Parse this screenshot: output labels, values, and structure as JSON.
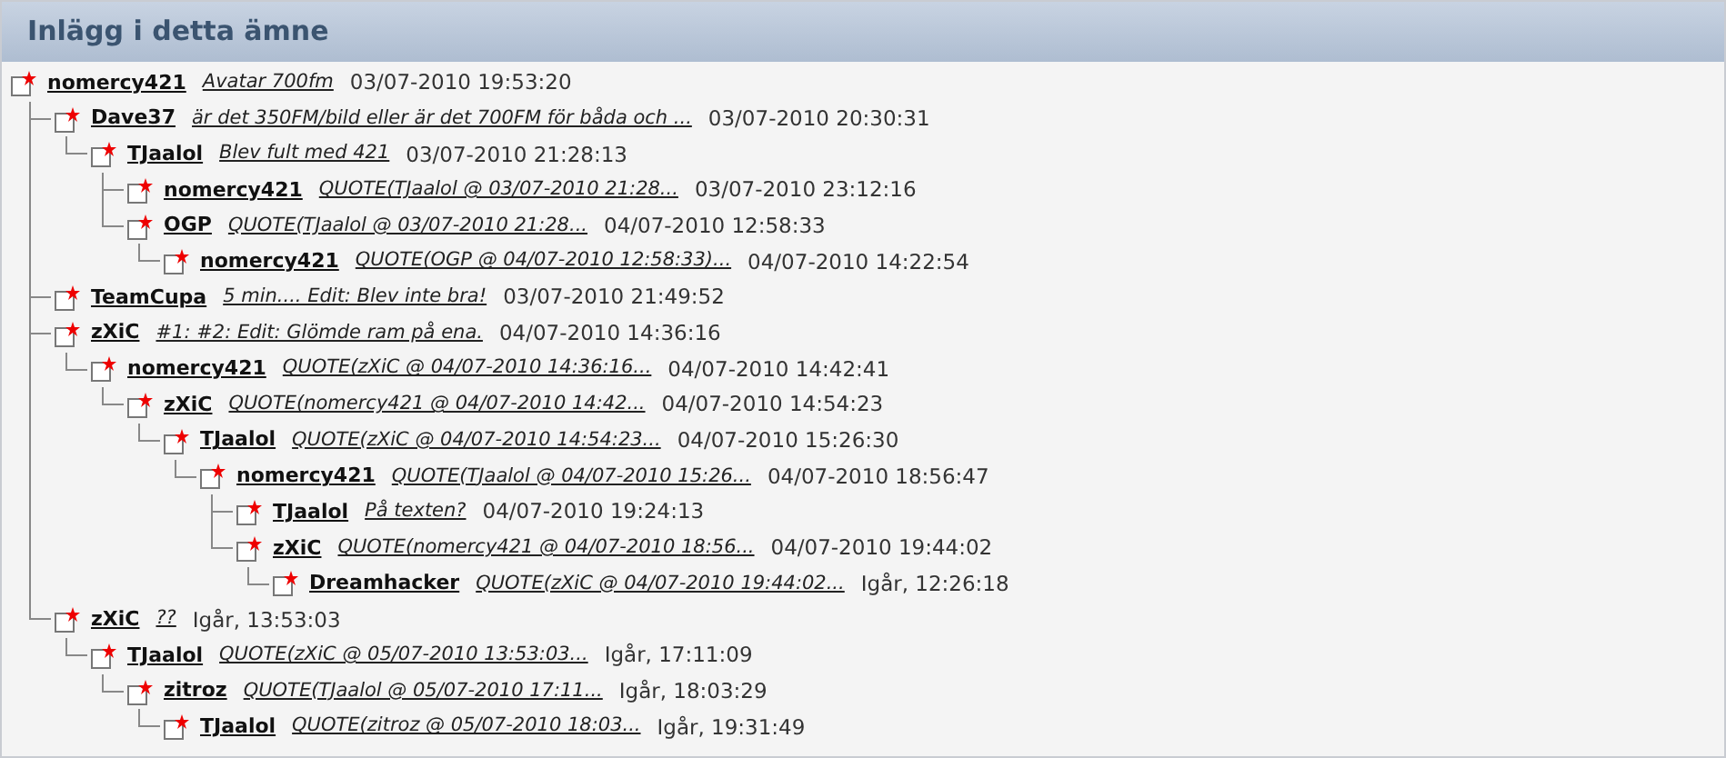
{
  "panel": {
    "title": "Inlägg i detta ämne"
  },
  "posts": [
    {
      "author": "nomercy421",
      "subject": "Avatar 700fm",
      "date": "03/07-2010 19:53:20",
      "children": [
        {
          "author": "Dave37",
          "subject": "är det 350FM/bild eller är det 700FM för båda och ...",
          "date": "03/07-2010 20:30:31",
          "children": [
            {
              "author": "TJaalol",
              "subject": "Blev fult med 421",
              "date": "03/07-2010 21:28:13",
              "children": [
                {
                  "author": "nomercy421",
                  "subject": "QUOTE(TJaalol @ 03/07-2010 21:28...",
                  "date": "03/07-2010 23:12:16"
                },
                {
                  "author": "OGP",
                  "subject": "QUOTE(TJaalol @ 03/07-2010 21:28...",
                  "date": "04/07-2010 12:58:33",
                  "children": [
                    {
                      "author": "nomercy421",
                      "subject": "QUOTE(OGP @ 04/07-2010 12:58:33)...",
                      "date": "04/07-2010 14:22:54"
                    }
                  ]
                }
              ]
            }
          ]
        },
        {
          "author": "TeamCupa",
          "subject": "5 min.... Edit: Blev inte bra!",
          "date": "03/07-2010 21:49:52"
        },
        {
          "author": "zXiC",
          "subject": "#1: #2: Edit: Glömde ram på ena.",
          "date": "04/07-2010 14:36:16",
          "children": [
            {
              "author": "nomercy421",
              "subject": "QUOTE(zXiC @ 04/07-2010 14:36:16...",
              "date": "04/07-2010 14:42:41",
              "children": [
                {
                  "author": "zXiC",
                  "subject": "QUOTE(nomercy421 @ 04/07-2010 14:42...",
                  "date": "04/07-2010 14:54:23",
                  "children": [
                    {
                      "author": "TJaalol",
                      "subject": "QUOTE(zXiC @ 04/07-2010 14:54:23...",
                      "date": "04/07-2010 15:26:30",
                      "children": [
                        {
                          "author": "nomercy421",
                          "subject": "QUOTE(TJaalol @ 04/07-2010 15:26...",
                          "date": "04/07-2010 18:56:47",
                          "children": [
                            {
                              "author": "TJaalol",
                              "subject": "På texten?",
                              "date": "04/07-2010 19:24:13"
                            },
                            {
                              "author": "zXiC",
                              "subject": "QUOTE(nomercy421 @ 04/07-2010 18:56...",
                              "date": "04/07-2010 19:44:02",
                              "children": [
                                {
                                  "author": "Dreamhacker",
                                  "subject": "QUOTE(zXiC @ 04/07-2010 19:44:02...",
                                  "date": "Igår, 12:26:18"
                                }
                              ]
                            }
                          ]
                        }
                      ]
                    }
                  ]
                }
              ]
            }
          ]
        },
        {
          "author": "zXiC",
          "subject": "??",
          "date": "Igår, 13:53:03",
          "children": [
            {
              "author": "TJaalol",
              "subject": "QUOTE(zXiC @ 05/07-2010 13:53:03...",
              "date": "Igår, 17:11:09",
              "children": [
                {
                  "author": "zitroz",
                  "subject": "QUOTE(TJaalol @ 05/07-2010 17:11...",
                  "date": "Igår, 18:03:29",
                  "children": [
                    {
                      "author": "TJaalol",
                      "subject": "QUOTE(zitroz @ 05/07-2010 18:03...",
                      "date": "Igår, 19:31:49"
                    }
                  ]
                }
              ]
            }
          ]
        }
      ]
    }
  ]
}
